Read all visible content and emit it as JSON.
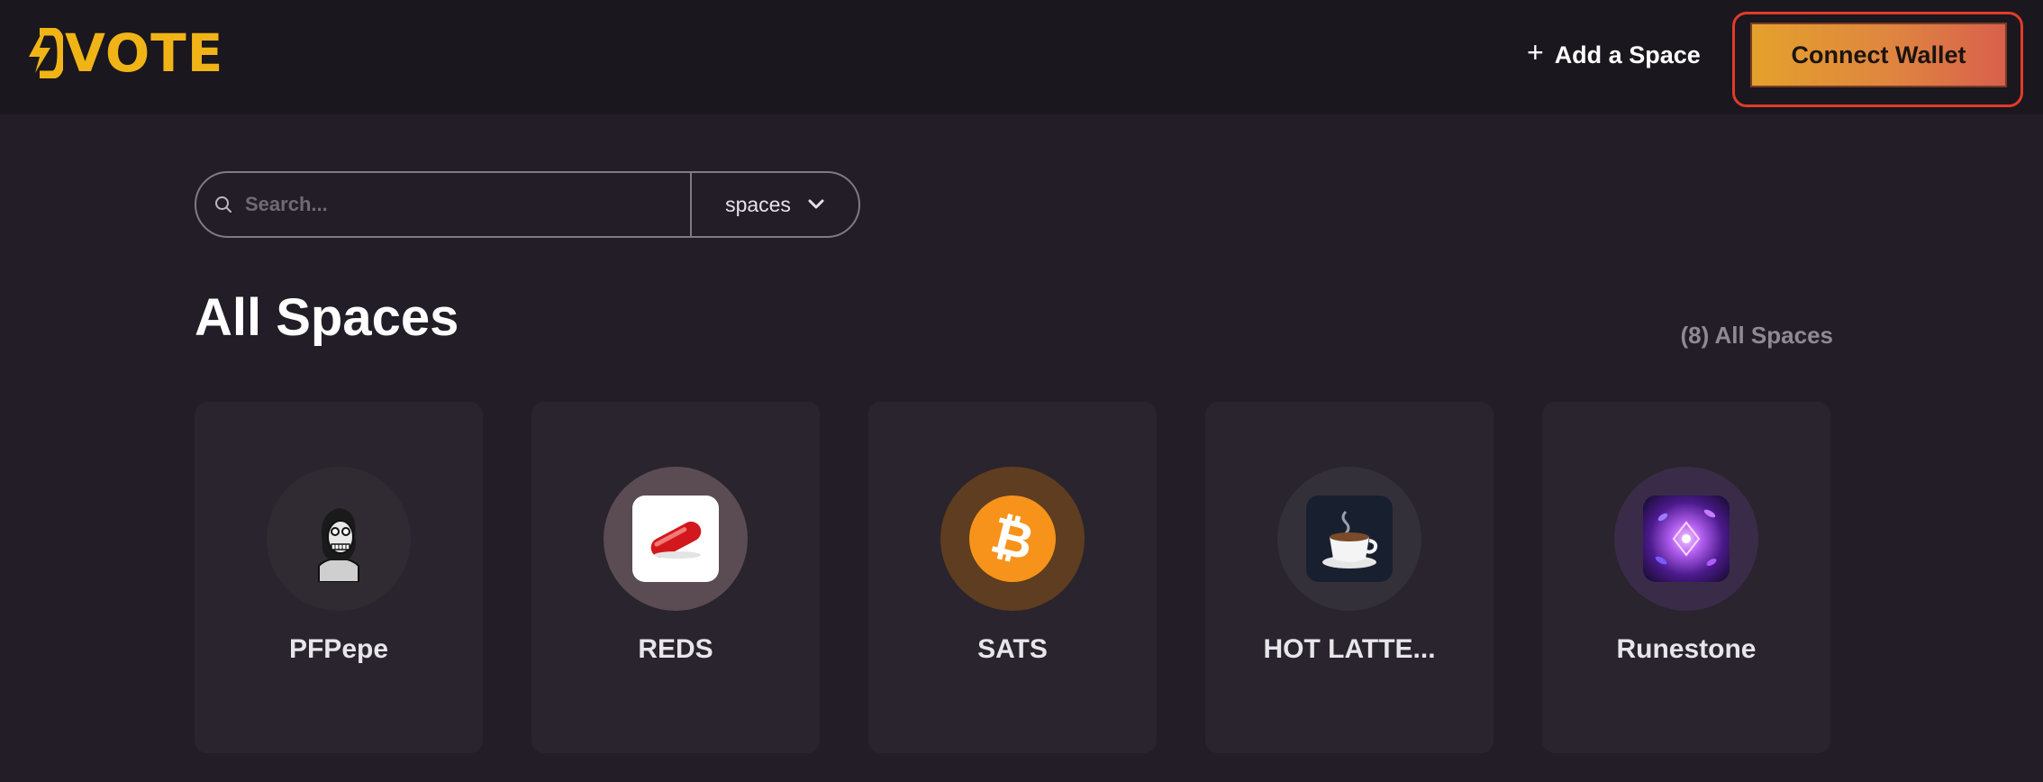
{
  "header": {
    "logo_text": "VOTE",
    "add_space_label": "Add a Space",
    "connect_wallet_label": "Connect Wallet"
  },
  "search": {
    "placeholder": "Search...",
    "value": "",
    "scope_selected": "spaces"
  },
  "main": {
    "title": "All Spaces",
    "count_label": "(8) All Spaces"
  },
  "spaces": [
    {
      "name": "PFPepe",
      "icon": "pepe-avatar-icon"
    },
    {
      "name": "REDS",
      "icon": "red-pill-icon"
    },
    {
      "name": "SATS",
      "icon": "bitcoin-icon"
    },
    {
      "name": "HOT LATTE...",
      "icon": "coffee-cup-icon"
    },
    {
      "name": "Runestone",
      "icon": "runestone-galaxy-icon"
    }
  ],
  "colors": {
    "brand_yellow": "#f0b417",
    "wallet_gradient_start": "#e4a12c",
    "wallet_gradient_end": "#d8604c",
    "focus_ring": "#e23b2a",
    "page_bg": "#221d26",
    "header_bg": "#1b171e"
  }
}
